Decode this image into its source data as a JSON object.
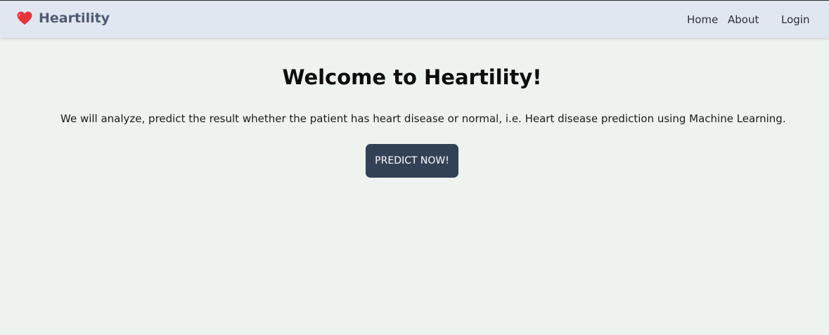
{
  "navbar": {
    "brand": "Heartility",
    "links": {
      "home": "Home",
      "about": "About",
      "login": "Login"
    }
  },
  "main": {
    "title": "Welcome to Heartility!",
    "description": "We will analyze, predict the result whether the patient has heart disease or normal, i.e. Heart disease prediction using Machine Learning.",
    "cta_label": "PREDICT NOW!"
  },
  "icons": {
    "brand_icon": "heart-icon"
  },
  "colors": {
    "navbar_bg": "#e1e7f0",
    "page_bg": "#eff3f0",
    "brand_text": "#4d5b72",
    "heart": "#e8323c",
    "button_bg": "#334155",
    "button_text": "#ffffff"
  }
}
